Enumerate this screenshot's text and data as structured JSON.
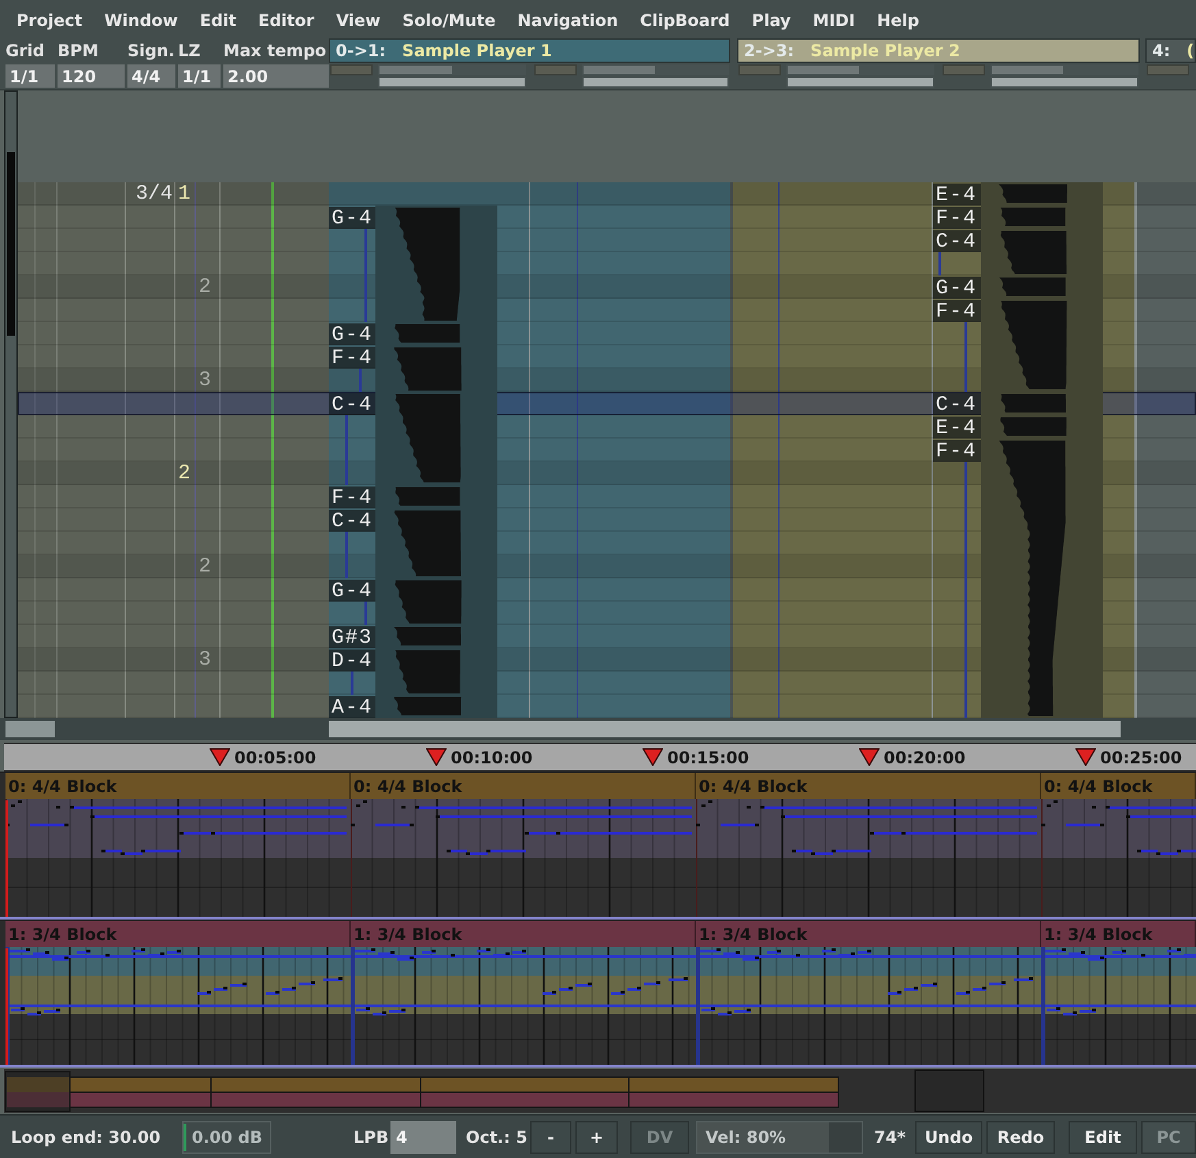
{
  "menu": [
    "Project",
    "Window",
    "Edit",
    "Editor",
    "View",
    "Solo/Mute",
    "Navigation",
    "ClipBoard",
    "Play",
    "MIDI",
    "Help"
  ],
  "song_settings": [
    {
      "label": "Grid",
      "value": "1/1"
    },
    {
      "label": "BPM",
      "value": "120"
    },
    {
      "label": "Sign.",
      "value": "4/4"
    },
    {
      "label": "LZ",
      "value": "1/1"
    },
    {
      "label": "Max tempo",
      "value": "2.00"
    }
  ],
  "tracks": [
    {
      "number": "0->1:",
      "name": "Sample Player 1",
      "color": "#3e6b76",
      "sliders": [
        {
          "level": 0.5
        },
        {
          "level": 1
        },
        {
          "level": 0.5
        },
        {
          "level": 1
        }
      ]
    },
    {
      "number": "2->3:",
      "name": "Sample Player 2",
      "color": "#a8a68a",
      "sliders": [
        {
          "level": 0.49
        },
        {
          "level": 1
        },
        {
          "level": 0.49
        },
        {
          "level": 1
        }
      ]
    },
    {
      "number": "4:",
      "name": "(",
      "color": "#4f5958"
    }
  ],
  "editor": {
    "tracks": [
      {
        "kind": "leading",
        "color": "#416670"
      },
      {
        "kind": "trailing",
        "color": "#696947"
      },
      {
        "kind": "empty",
        "color": "#56605f"
      }
    ],
    "rows": [
      {
        "selected": false,
        "signature": "3/4",
        "bar": "1",
        "note_2": {
          "pitch": "E-4"
        }
      },
      {
        "selected": false,
        "note_1": {
          "pitch": "G-4",
          "level": 0.76
        },
        "note_2": {
          "pitch": "F-4"
        }
      },
      {
        "selected": false,
        "note_2": {
          "pitch": "C-4",
          "level": 0.12
        }
      },
      {
        "selected": false
      },
      {
        "selected": false,
        "beat": "2",
        "note_2": {
          "pitch": "G-4"
        }
      },
      {
        "selected": false,
        "note_2": {
          "pitch": "F-4",
          "level": 0.67
        }
      },
      {
        "selected": false,
        "note_1": {
          "pitch": "G-4"
        }
      },
      {
        "selected": false,
        "note_1": {
          "pitch": "F-4",
          "level": 0.65
        }
      },
      {
        "selected": false,
        "beat": "3"
      },
      {
        "selected": true,
        "note_1": {
          "pitch": "C-4",
          "level": 0.35
        },
        "note_2": {
          "pitch": "C-4"
        }
      },
      {
        "selected": false,
        "note_2": {
          "pitch": "E-4"
        }
      },
      {
        "selected": false,
        "note_2": {
          "pitch": "F-4",
          "level": 0.67
        }
      },
      {
        "selected": false,
        "bar": "2"
      },
      {
        "selected": false,
        "note_1": {
          "pitch": "F-4"
        }
      },
      {
        "selected": false,
        "note_1": {
          "pitch": "C-4",
          "level": 0.35
        }
      },
      {
        "selected": false
      },
      {
        "selected": false,
        "beat": "2"
      },
      {
        "selected": false,
        "note_1": {
          "pitch": "G-4",
          "level": 0.76
        }
      },
      {
        "selected": false
      },
      {
        "selected": false,
        "note_1": {
          "pitch": "G#3"
        }
      },
      {
        "selected": false,
        "beat": "3",
        "note_1": {
          "pitch": "D-4",
          "level": 0.47
        }
      },
      {
        "selected": false
      },
      {
        "selected": false,
        "note_1": {
          "pitch": "A-4"
        }
      }
    ]
  },
  "sequencer": {
    "timeline": [
      "00:05:00",
      "00:10:00",
      "00:15:00",
      "00:20:00",
      "00:25:00"
    ],
    "tracks": [
      {
        "kind": "single",
        "color": "#6d5325",
        "blocks": [
          "0: 4/4 Block",
          "0: 4/4 Block",
          "0: 4/4 Block",
          "0: 4/4 Block"
        ]
      },
      {
        "kind": "double",
        "color": "#6b3444",
        "blocks": [
          "1: 3/4 Block",
          "1: 3/4 Block",
          "1: 3/4 Block",
          "1: 3/4 Block"
        ]
      }
    ]
  },
  "status_bar": {
    "loop_end": "Loop end: 30.00",
    "volume": {
      "reading": "0.00 dB",
      "level": 0
    },
    "lpb": {
      "label": "LPB",
      "value": "4"
    },
    "octave": "Oct.: 5",
    "octave_buttons": [
      "-",
      "+"
    ],
    "dv": {
      "label": "DV",
      "on": false
    },
    "velocity": {
      "reading": "Vel: 80%",
      "level": 0.8
    },
    "edit_count": "74*",
    "history_buttons": [
      "Undo",
      "Redo"
    ],
    "modes": [
      {
        "label": "Edit",
        "selected": true
      },
      {
        "label": "PC",
        "selected": false
      }
    ]
  }
}
